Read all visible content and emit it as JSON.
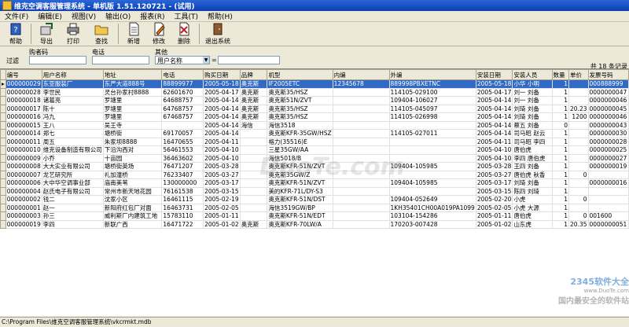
{
  "title": "维克空调客服管理系统 - 单机版 1.51.120721 - (试用)",
  "menu": [
    "文件(F)",
    "编辑(E)",
    "视图(V)",
    "输出(O)",
    "报表(R)",
    "工具(T)",
    "帮助(H)"
  ],
  "toolbar": {
    "help": "帮助",
    "export": "导出",
    "print": "打印",
    "find": "查找",
    "new": "新增",
    "edit": "修改",
    "delete": "删除",
    "exit": "退出系统"
  },
  "filter": {
    "label": "过滤",
    "buyer_label": "购者码",
    "phone_label": "电话",
    "other_label": "其他",
    "field_value": "用户名称",
    "eq": "="
  },
  "count_text": "共 18 条记录",
  "columns": [
    "编号",
    "用户名称",
    "地址",
    "电话",
    "购买日期",
    "品牌",
    "机型",
    "内编",
    "外编",
    "安装日期",
    "安装人员",
    "数量",
    "单价",
    "发票号码"
  ],
  "rows": [
    [
      "000000029",
      "东亚服装厂",
      "东严大道888号",
      "88899977",
      "2005-05-18",
      "奥克斯",
      "IF2005ETC",
      "12345678",
      "889998PBXETNC",
      "2005-05-18",
      "小华 小明",
      "1",
      "",
      "000888999"
    ],
    [
      "000000028",
      "李世民",
      "灵台孙家村8888",
      "62601670",
      "2005-04-17",
      "奥克斯",
      "奥克斯35/HSZ",
      "",
      "114105-029100",
      "2005-04-17",
      "刘一 刘备",
      "1",
      "",
      "0000000047"
    ],
    [
      "000000018",
      "诸葛亮",
      "罗塘里",
      "64688757",
      "2005-04-14",
      "奥克斯",
      "奥克斯51N/ZVT",
      "",
      "109404-106027",
      "2005-04-14",
      "刘一 刘备",
      "1",
      "",
      "0000000046"
    ],
    [
      "000000017",
      "陈十",
      "罗塘里",
      "64768757",
      "2005-04-14",
      "奥克斯",
      "奥克斯35/HSZ",
      "",
      "114105-045097",
      "2005-04-14",
      "刘琦 刘备",
      "1",
      "20.23",
      "0000000045"
    ],
    [
      "000000016",
      "冯九",
      "罗塘里",
      "67468757",
      "2005-04-14",
      "奥克斯",
      "奥克斯35/HSZ",
      "",
      "114105-026998",
      "2005-04-14",
      "刘琦 刘备",
      "1",
      "1200",
      "0000000046"
    ],
    [
      "000000015",
      "王八",
      "吴王寺",
      "",
      "2005-04-14",
      "海信",
      "海信3518",
      "",
      "",
      "2005-04-14",
      "蔡五 刘备",
      "0",
      "",
      "0000000043"
    ],
    [
      "000000014",
      "郑七",
      "塘桥街",
      "69170057",
      "2005-04-14",
      "",
      "奥克斯KFR-35GW/HSZ",
      "",
      "114105-027011",
      "2005-04-14",
      "司马昭 赵云",
      "1",
      "",
      "0000000030"
    ],
    [
      "000000011",
      "周五",
      "朱家坝8888",
      "16470655",
      "2005-04-11",
      "",
      "格力(35516)E",
      "",
      "",
      "2005-04-11",
      "司马昭 李四",
      "1",
      "",
      "0000000028"
    ],
    [
      "000000010",
      "维克设备制造有限公司",
      "下沿沟西对",
      "56461553",
      "2005-04-10",
      "",
      "三星35GW/AA",
      "",
      "",
      "2005-04-10",
      "唐伯虎",
      "1",
      "",
      "0000000025"
    ],
    [
      "000000009",
      "小乔",
      "十亩园",
      "36463602",
      "2005-04-10",
      "",
      "海信5018/B",
      "",
      "",
      "2005-04-10",
      "李四 唐伯虎",
      "1",
      "",
      "0000000027"
    ],
    [
      "000000008",
      "大大实业有限公司",
      "塘桥街英场",
      "76471207",
      "2005-03-28",
      "",
      "奥克斯KFR-51N/ZVT",
      "",
      "109404-105985",
      "2005-03-28",
      "王四 刘备",
      "1",
      "",
      "0000000019"
    ],
    [
      "000000007",
      "龙艺研究所",
      "礼加潼桥",
      "76233407",
      "2005-03-27",
      "",
      "奥克斯35GW/Z",
      "",
      "",
      "2005-03-27",
      "唐伯虎 秋香",
      "1",
      "0",
      ""
    ],
    [
      "000000006",
      "大中华空调事业部",
      "庙南美苇",
      "130000000",
      "2005-03-17",
      "",
      "奥克斯KFR-51N/ZVT",
      "",
      "109404-105985",
      "2005-03-17",
      "刘琦 刘备",
      "1",
      "",
      "0000000016"
    ],
    [
      "000000004",
      "赵氏电子有限公司",
      "常州市新天地花园",
      "76161538",
      "2005-03-15",
      "",
      "美的KFR-71L/DY-S3",
      "",
      "",
      "2005-03-15",
      "陈四 刘琦",
      "1",
      "",
      ""
    ],
    [
      "000000002",
      "钱二",
      "沈家小区",
      "16461115",
      "2005-02-19",
      "",
      "奥克斯KFR-51N/DST",
      "",
      "109404-052649",
      "2005-02-20",
      "小虎",
      "1",
      "0",
      ""
    ],
    [
      "000000001",
      "赵一",
      "新阳府红包厂对面",
      "16463731",
      "2005-02-05",
      "",
      "海信3519GW/BP",
      "",
      "1KH35401CH00A019PA1099",
      "2005-02-05",
      "小虎 大源",
      "1",
      "",
      ""
    ],
    [
      "000000003",
      "孙三",
      "威利斯厂内建筑工地",
      "15783110",
      "2005-01-11",
      "",
      "奥克斯KFR-51N/EDT",
      "",
      "103104-154286",
      "2005-01-11",
      "唐伯虎",
      "1",
      "0",
      "001600"
    ],
    [
      "000000019",
      "李四",
      "新联广西",
      "16471722",
      "2005-01-02",
      "奥克斯",
      "奥克斯KFR-70LW/A",
      "",
      "170203-007428",
      "2005-01-02",
      "山东虎",
      "1",
      "20.35",
      "0000000051"
    ]
  ],
  "status_path": "C:\\Program Files\\维克空调客服管理系统\\vkcrmkt.mdb",
  "watermarks": {
    "center": "DuoTe.com",
    "corner_brand": "2345软件大全",
    "corner_url": "www.DuoTe.com",
    "corner_slogan": "国内最安全的软件站"
  }
}
